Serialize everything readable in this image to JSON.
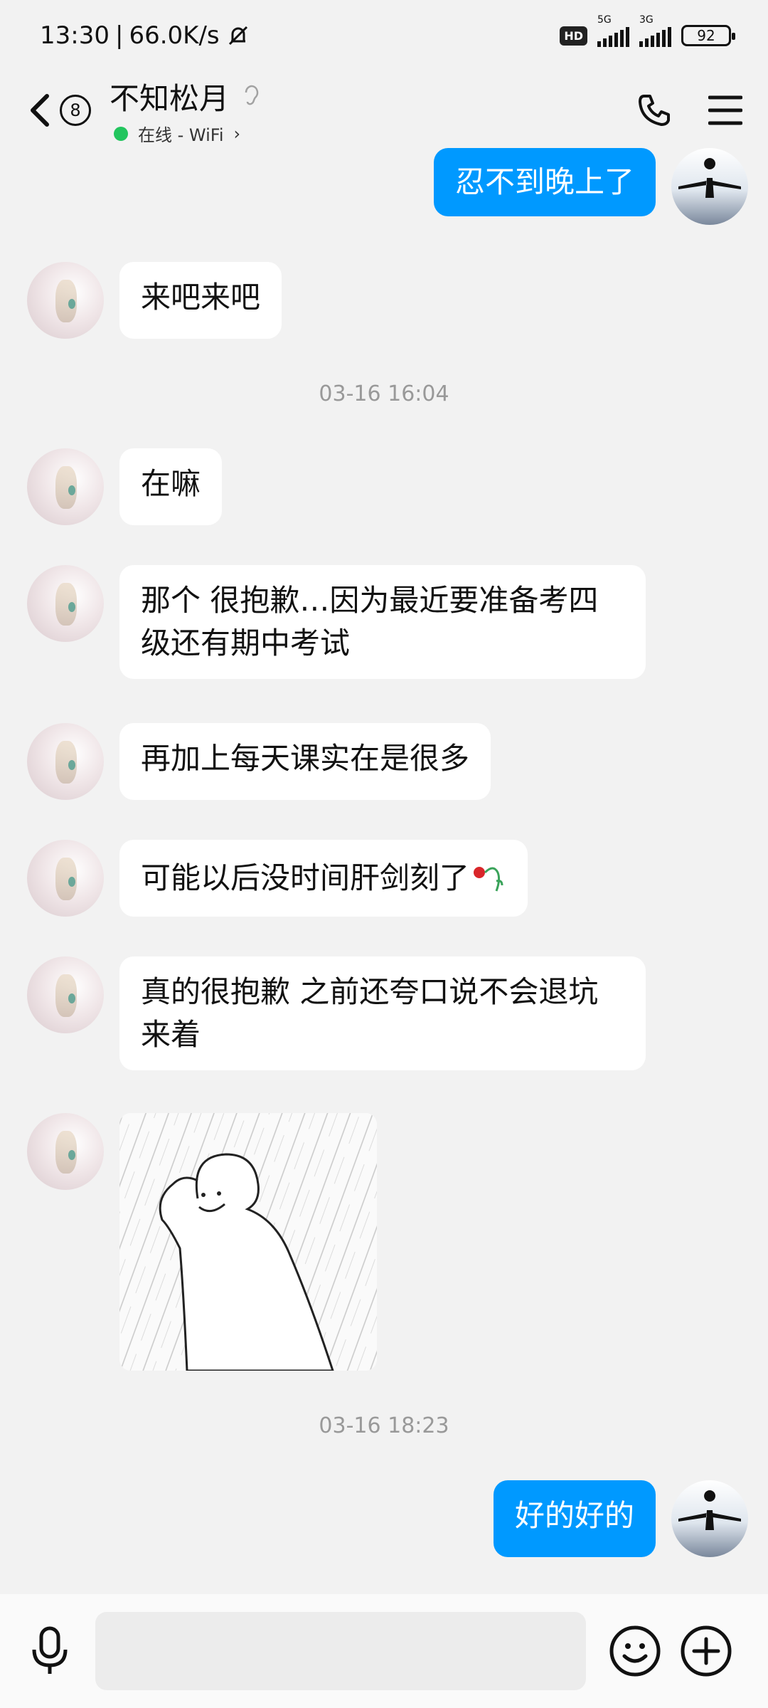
{
  "status": {
    "time": "13:30",
    "speed": "66.0K/s",
    "hd": "HD",
    "net1": "5G",
    "net2": "3G",
    "battery": "92"
  },
  "header": {
    "badge": "8",
    "title": "不知松月",
    "status": "在线 - WiFi"
  },
  "messages": [
    {
      "text": "忍不到晚上了"
    },
    {
      "text": "来吧来吧"
    },
    {
      "time": "03-16 16:04"
    },
    {
      "text": "在嘛"
    },
    {
      "text": "那个 很抱歉…因为最近要准备考四级还有期中考试"
    },
    {
      "text": "再加上每天课实在是很多"
    },
    {
      "text": "可能以后没时间肝剑刻了"
    },
    {
      "text": "真的很抱歉 之前还夸口说不会退坑来着"
    },
    {
      "time": "03-16 18:23"
    },
    {
      "text": "好的好的"
    }
  ],
  "colors": {
    "accent": "#0099ff",
    "online": "#22c55e",
    "background": "#f2f2f2"
  },
  "icons": {
    "back": "chevron-left-icon",
    "call": "phone-icon",
    "menu": "menu-icon",
    "voice": "microphone-icon",
    "emoji": "emoji-icon",
    "more": "plus-icon"
  }
}
